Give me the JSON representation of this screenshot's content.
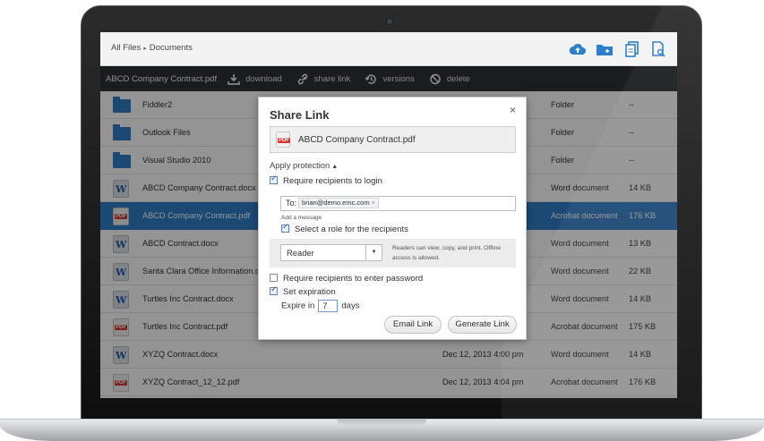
{
  "header": {
    "crumb_root": "All Files",
    "crumb_sep": "▸",
    "crumb_current": "Documents"
  },
  "toolbar": {
    "selected_file": "ABCD Company Contract.pdf",
    "download": "download",
    "share_link": "share link",
    "versions": "versions",
    "delete": "delete"
  },
  "files": [
    {
      "name": "Fiddler2",
      "modified": "",
      "type": "Folder",
      "size": "--",
      "icon": "folder-icon"
    },
    {
      "name": "Outlook Files",
      "modified": "",
      "type": "Folder",
      "size": "--",
      "icon": "folder-icon"
    },
    {
      "name": "Visual Studio 2010",
      "modified": "",
      "type": "Folder",
      "size": "--",
      "icon": "folder-icon"
    },
    {
      "name": "ABCD Company Contract.docx",
      "modified": "",
      "type": "Word document",
      "size": "14 KB",
      "icon": "word-icon"
    },
    {
      "name": "ABCD Company Contract.pdf",
      "modified": "",
      "type": "Acrobat document",
      "size": "176 KB",
      "icon": "pdf-icon"
    },
    {
      "name": "ABCD Contract.docx",
      "modified": "",
      "type": "Word document",
      "size": "13 KB",
      "icon": "word-icon"
    },
    {
      "name": "Santa Clara Office Information.dc",
      "modified": "",
      "type": "Word document",
      "size": "22 KB",
      "icon": "word-icon"
    },
    {
      "name": "Turtles Inc Contract.docx",
      "modified": "",
      "type": "Word document",
      "size": "14 KB",
      "icon": "word-icon"
    },
    {
      "name": "Turtles Inc Contract.pdf",
      "modified": "",
      "type": "Acrobat document",
      "size": "175 KB",
      "icon": "pdf-icon"
    },
    {
      "name": "XYZQ Contract.docx",
      "modified": "Dec 12, 2013 4:00 pm",
      "type": "Word document",
      "size": "14 KB",
      "icon": "word-icon"
    },
    {
      "name": "XYZQ Contract_12_12.pdf",
      "modified": "Dec 12, 2013 4:04 pm",
      "type": "Acrobat document",
      "size": "176 KB",
      "icon": "pdf-icon"
    }
  ],
  "dialog": {
    "title": "Share Link",
    "close": "×",
    "file_name": "ABCD Company Contract.pdf",
    "pdf_badge": "PDF",
    "apply_protection": "Apply protection",
    "apply_caret": "▲",
    "require_login": "Require recipients to login",
    "to_label": "To:",
    "recipient": "brian@demo.emc.com",
    "recipient_remove": "×",
    "add_message": "Add a message",
    "select_role": "Select a role for the recipients",
    "role_value": "Reader",
    "role_hint": "Readers can view, copy, and print. Offline access is allowed.",
    "require_password": "Require recipients to enter password",
    "set_expiration": "Set expiration",
    "expire_in": "Expire in",
    "expire_days": "7",
    "days": "days",
    "email_link": "Email Link",
    "generate_link": "Generate Link"
  },
  "colors": {
    "selected_row": "#2f7fc8",
    "toolbar_bg": "#2e3338",
    "accent_blue": "#2f7fc8"
  }
}
